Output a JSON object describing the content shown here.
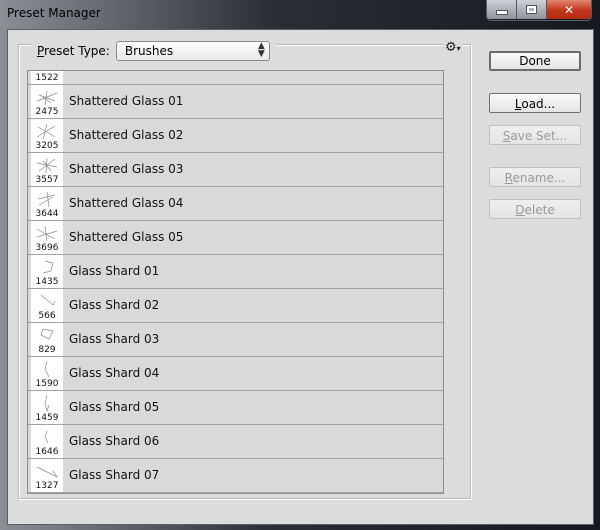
{
  "window": {
    "title": "Preset Manager",
    "controls": {
      "minimize": "minimize",
      "maximize": "maximize",
      "close": "✕"
    }
  },
  "preset_type": {
    "label_accel": "P",
    "label_rest": "reset Type:",
    "value": "Brushes"
  },
  "gear_menu": {
    "icon": "⚙",
    "arrow": "▾"
  },
  "brushes": [
    {
      "size": "1522",
      "name": ""
    },
    {
      "size": "2475",
      "name": "Shattered Glass 01"
    },
    {
      "size": "3205",
      "name": "Shattered Glass 02"
    },
    {
      "size": "3557",
      "name": "Shattered Glass 03"
    },
    {
      "size": "3644",
      "name": "Shattered Glass 04"
    },
    {
      "size": "3696",
      "name": "Shattered Glass 05"
    },
    {
      "size": "1435",
      "name": "Glass Shard 01"
    },
    {
      "size": "566",
      "name": "Glass Shard 02"
    },
    {
      "size": "829",
      "name": "Glass Shard 03"
    },
    {
      "size": "1590",
      "name": "Glass Shard 04"
    },
    {
      "size": "1459",
      "name": "Glass Shard 05"
    },
    {
      "size": "1646",
      "name": "Glass Shard 06"
    },
    {
      "size": "1327",
      "name": "Glass Shard 07"
    }
  ],
  "scrollbar": {
    "up": "▲",
    "down": "▼",
    "position_fraction": 1.0
  },
  "buttons": {
    "done": {
      "label": "Done",
      "enabled": true
    },
    "load": {
      "accel": "L",
      "rest": "oad...",
      "enabled": true
    },
    "save_set": {
      "accel": "S",
      "rest": "ave Set...",
      "enabled": false
    },
    "rename": {
      "accel": "R",
      "rest": "ename...",
      "enabled": false
    },
    "delete": {
      "accel": "D",
      "rest": "elete",
      "enabled": false
    }
  }
}
